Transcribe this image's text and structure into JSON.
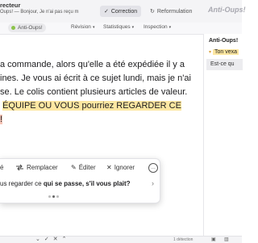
{
  "header": {
    "app_title": "recteur",
    "doc_subtitle": "Oups! — Bonjour, Je n'ai pas reçu m",
    "tabs": [
      {
        "label": "Correction",
        "active": true
      },
      {
        "label": "Reformulation",
        "active": false
      }
    ],
    "brand": "Anti-Oups!"
  },
  "menu": {
    "items": [
      {
        "label": "Anti-Oups!",
        "active": true
      },
      {
        "label": "Révision"
      },
      {
        "label": "Statistiques"
      },
      {
        "label": "Inspection"
      }
    ]
  },
  "document": {
    "lines": [
      {
        "text": "a commande, alors qu'elle a été expédiée il y a"
      },
      {
        "text": "ines. Je vous ai écrit à ce sujet lundi, mais je n'ai"
      },
      {
        "text": "se. Le colis contient plusieurs articles de valeur."
      },
      {
        "highlighted": "ÉQUIPE OU VOUS pourriez REGARDER CE"
      },
      {
        "highlighted_red": "!"
      }
    ]
  },
  "side_panel": {
    "title": "Anti-Oups!",
    "issue_label": "Ton vexa",
    "suggestion": "Est-ce qu"
  },
  "popup": {
    "actions": {
      "partial": "é",
      "replace": "Remplacer",
      "edit": "Éditer",
      "ignore": "Ignorer",
      "more": "…"
    },
    "suggestion_prefix": "us regarder ce",
    "suggestion_bold": "qui se passe, s'il vous plait?",
    "next_arrow": "›",
    "page_count": 3,
    "current_page": 2
  },
  "footer": {
    "detections": "1 détection"
  },
  "colors": {
    "highlight": "#fde7a2",
    "highlight_red": "#f7c6b8",
    "active_dot": "#8bc34a"
  }
}
